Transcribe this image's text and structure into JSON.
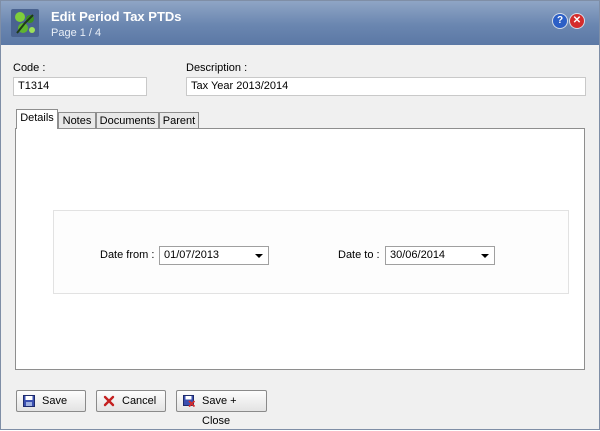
{
  "window": {
    "title": "Edit Period Tax PTDs",
    "subtitle": "Page 1 / 4",
    "help_icon": "question-icon",
    "close_icon": "close-icon"
  },
  "form": {
    "code_label": "Code :",
    "code_value": "T1314",
    "description_label": "Description :",
    "description_value": "Tax Year 2013/2014"
  },
  "tabs": [
    {
      "label": "Details",
      "active": true
    },
    {
      "label": "Notes",
      "active": false
    },
    {
      "label": "Documents",
      "active": false
    },
    {
      "label": "Parent",
      "active": false
    }
  ],
  "details": {
    "date_from_label": "Date from :",
    "date_from_value": "01/07/2013",
    "date_to_label": "Date to :",
    "date_to_value": "30/06/2014"
  },
  "buttons": {
    "save": "Save",
    "cancel": "Cancel",
    "save_close": "Save + Close"
  }
}
